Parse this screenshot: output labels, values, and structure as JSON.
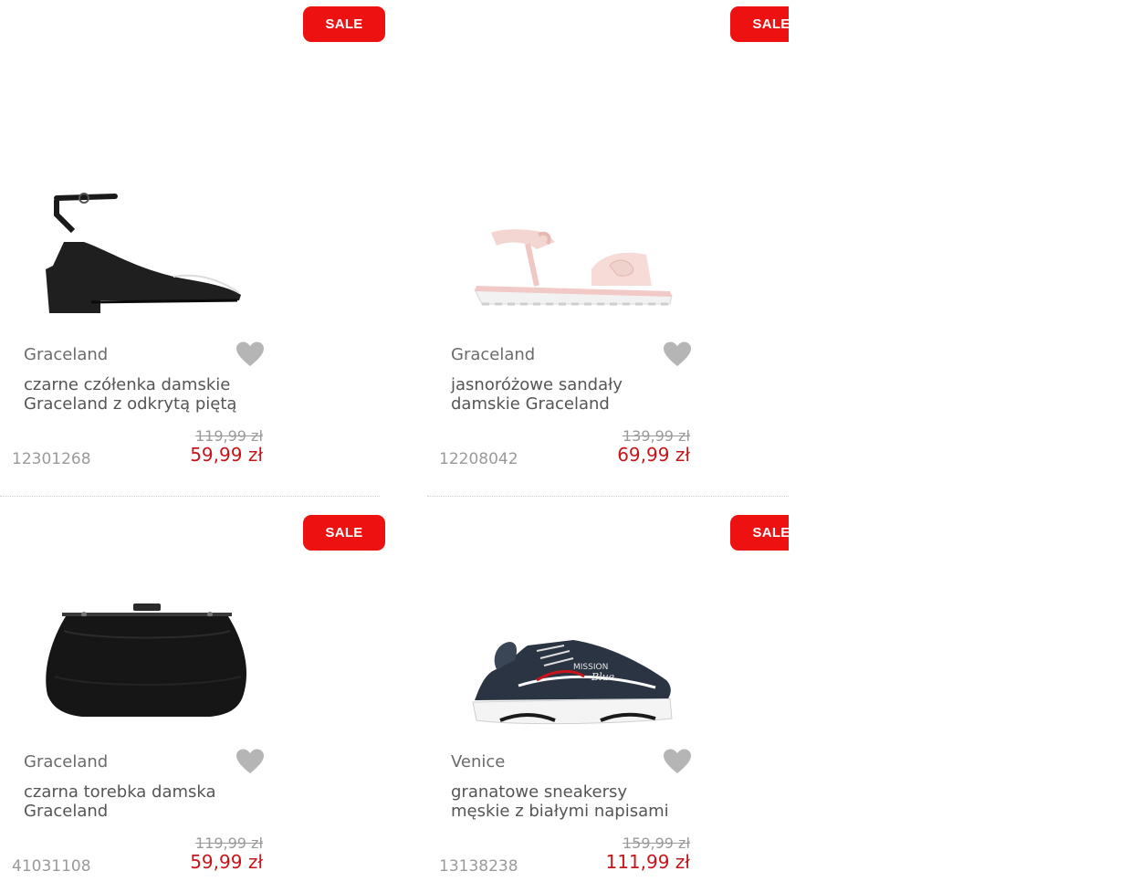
{
  "products": [
    {
      "badge": "SALE",
      "brand": "Graceland",
      "title": "czarne czółenka damskie Graceland z odkrytą piętą",
      "sku": "12301268",
      "old_price": "119,99 zł",
      "price": "59,99 zł",
      "image_icon": "black-heeled-sandal-image"
    },
    {
      "badge": "SALE",
      "brand": "Graceland",
      "title": "jasnoróżowe sandały damskie Graceland",
      "sku": "12208042",
      "old_price": "139,99 zł",
      "price": "69,99 zł",
      "image_icon": "pink-sandal-image"
    },
    {
      "badge": "SALE",
      "brand": "Graceland",
      "title": "czarna torebka damska Graceland",
      "sku": "41031108",
      "old_price": "119,99 zł",
      "price": "59,99 zł",
      "image_icon": "black-clutch-bag-image"
    },
    {
      "badge": "SALE",
      "brand": "Venice",
      "title": "granatowe sneakersy męskie z białymi napisami",
      "sku": "13138238",
      "old_price": "159,99 zł",
      "price": "111,99 zł",
      "image_icon": "navy-sneaker-image"
    }
  ],
  "colors": {
    "sale": "#ee1111",
    "price": "#c8151b",
    "text": "#555555",
    "muted": "#9a9a9a",
    "wishlist_icon": "#b5b5b5"
  }
}
